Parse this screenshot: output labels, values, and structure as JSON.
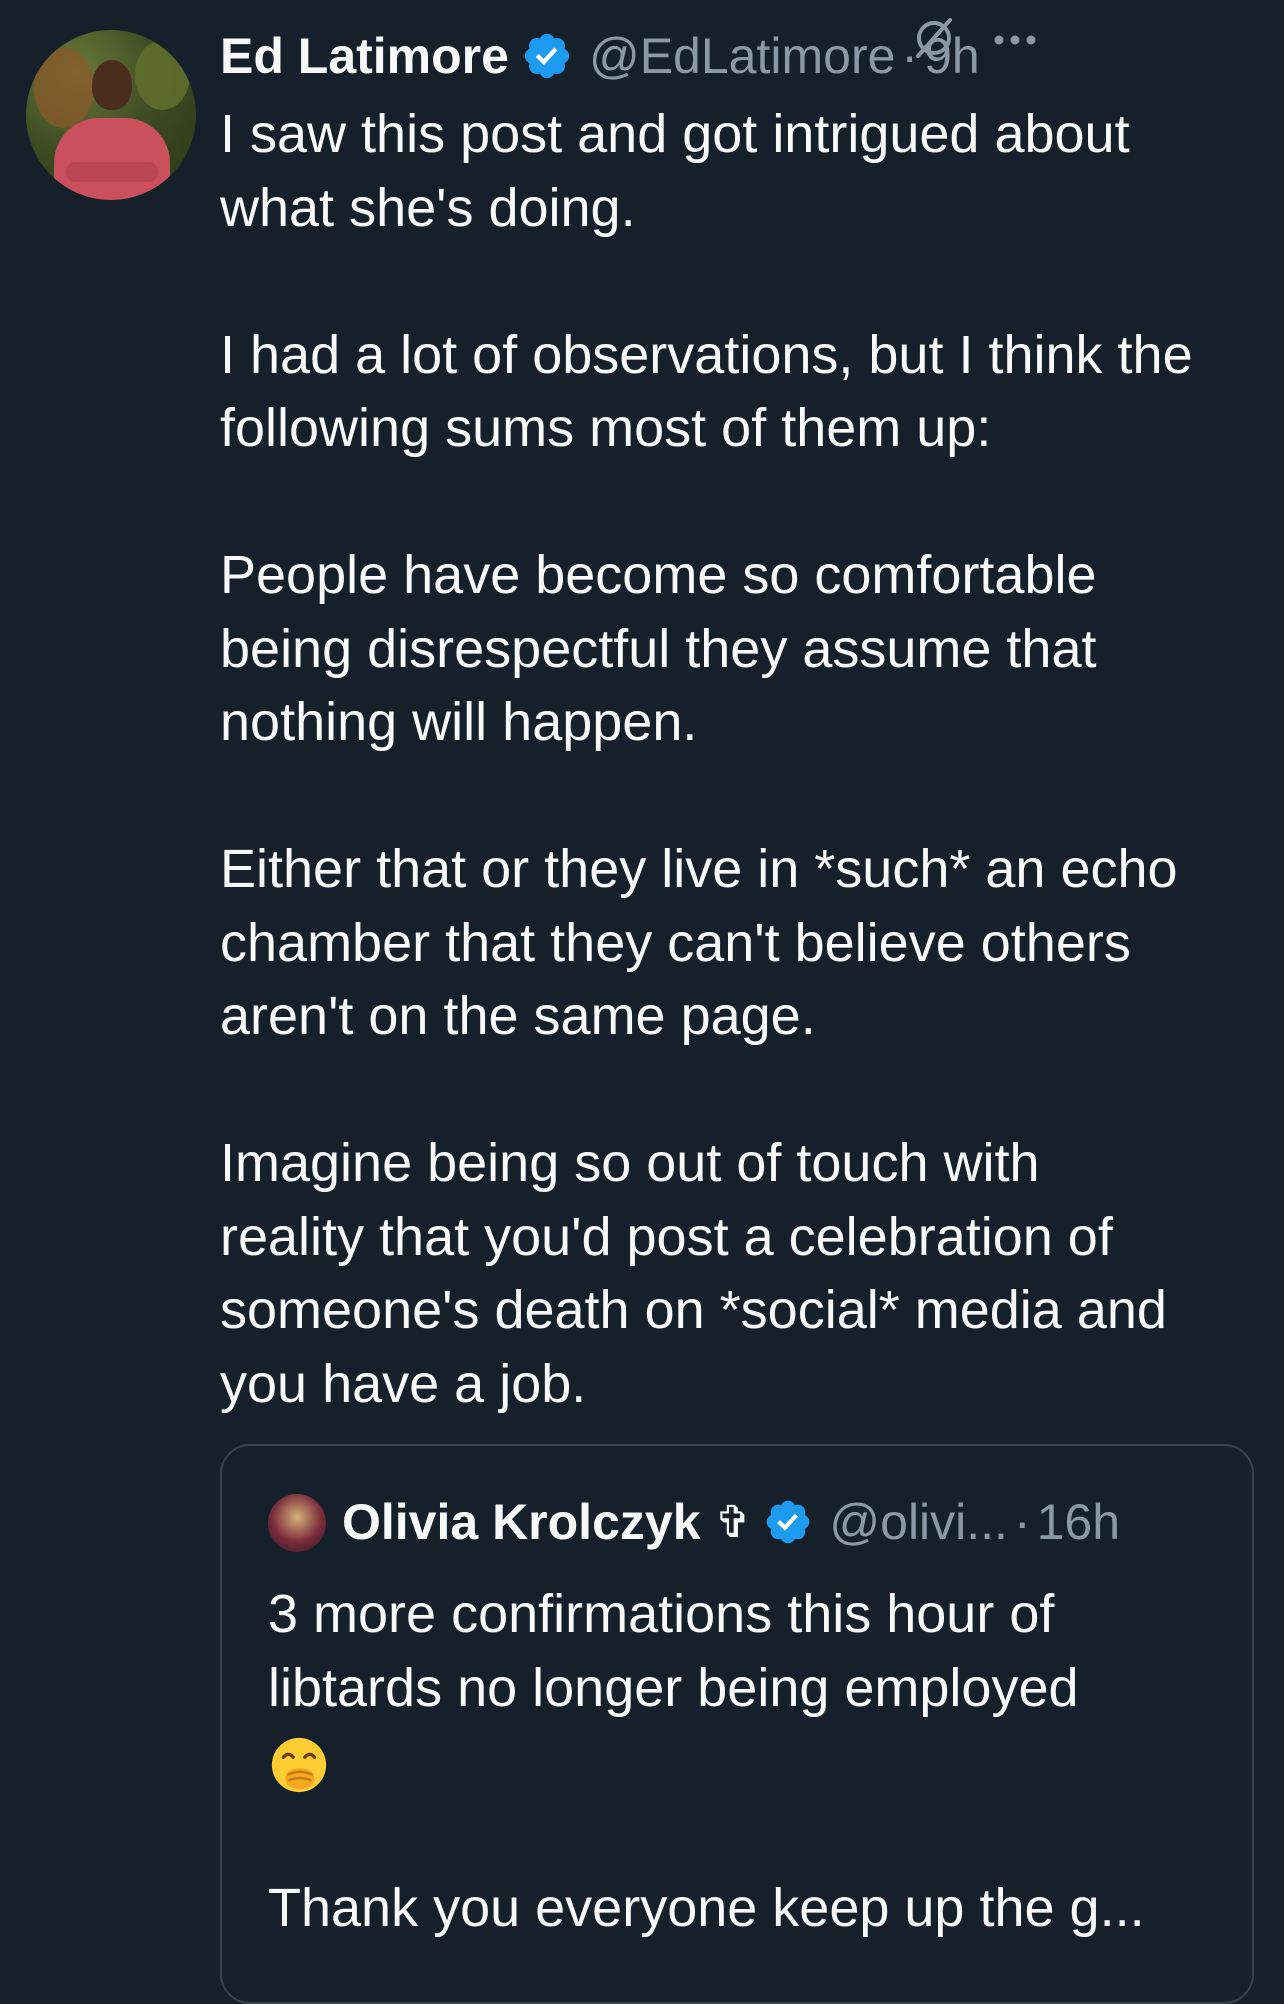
{
  "tweet": {
    "author_name": "Ed Latimore",
    "author_handle": "@EdLatimore",
    "separator": "·",
    "time": "9h",
    "paragraphs": [
      [
        "I saw this post and got intrigued about",
        "what she's doing."
      ],
      [
        "I had a lot of observations, but I think the",
        "following sums most of them up:"
      ],
      [
        "People have become so comfortable",
        "being disrespectful they assume that",
        "nothing will happen."
      ],
      [
        "Either that or they live in *such* an echo",
        "chamber that they can't believe others",
        "aren't on the same page."
      ],
      [
        "Imagine being so out of touch with",
        "reality that you'd post a celebration of",
        "someone's death on *social* media and",
        "you have a job."
      ]
    ],
    "icons": {
      "verified": "verified-badge-icon",
      "mute": "mute-icon",
      "more": "more-options-icon"
    },
    "accent_color": "#1d9bf0"
  },
  "quote": {
    "author_name": "Olivia Krolczyk",
    "name_symbol": "✞",
    "author_handle": "@olivi...",
    "separator": "·",
    "time": "16h",
    "lines": [
      "3 more confirmations this hour of",
      "libtards no longer being employed"
    ],
    "emoji": "face-with-hand-over-mouth-emoji",
    "last_line": "Thank you everyone keep up the g..."
  }
}
